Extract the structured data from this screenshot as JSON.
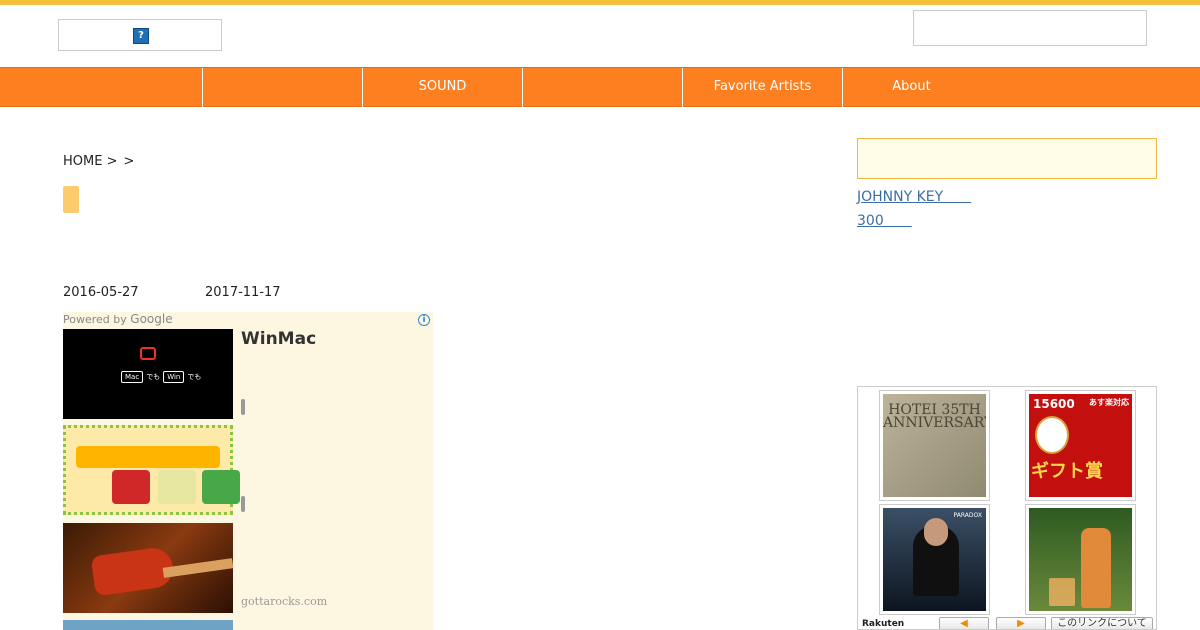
{
  "header": {
    "logo_icon": "broken-image-icon",
    "logo_glyph": "?",
    "search_placeholder": ""
  },
  "nav": {
    "items": [
      {
        "label": ""
      },
      {
        "label": ""
      },
      {
        "label": "SOUND"
      },
      {
        "label": ""
      },
      {
        "label": "Favorite Artists"
      },
      {
        "label": "About"
      }
    ],
    "color": "#fd7f20"
  },
  "breadcrumb": {
    "home": "HOME >",
    "sep": ">"
  },
  "post": {
    "published": "2016-05-27",
    "updated": "2017-11-17"
  },
  "ad": {
    "powered_by": "Powered by ",
    "google": "Google",
    "info_glyph": "i",
    "title": "WinMac",
    "mac_label": "Mac",
    "win_label": "Win",
    "de": "でも",
    "domain": "gottarocks.com"
  },
  "sidebar": {
    "search_placeholder": "",
    "links": [
      {
        "label": "JOHNNY KEY　　"
      },
      {
        "label": "300　　"
      }
    ]
  },
  "rakuten": {
    "p1_text": "HOTEI 35TH ANNIVERSARY",
    "p2_num": "15600",
    "p2_badge": "あす楽対応",
    "p2_gift": "ギフト賞",
    "p3_tag": "PARADOX",
    "logo": "Rakuten",
    "prev": "◀",
    "next": "▶",
    "about": "このリンクについて"
  }
}
